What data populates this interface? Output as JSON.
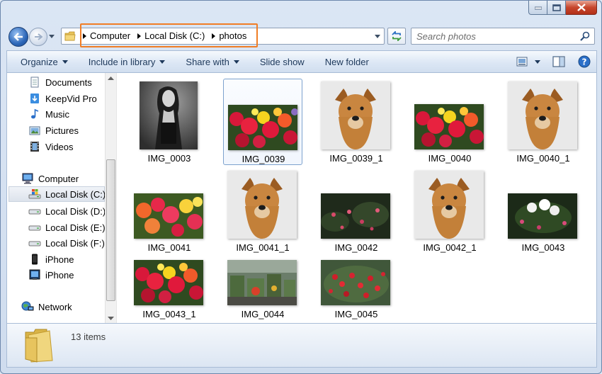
{
  "breadcrumb": [
    "Computer",
    "Local Disk (C:)",
    "photos"
  ],
  "search": {
    "placeholder": "Search photos"
  },
  "toolbar": {
    "organize": "Organize",
    "include_in_library": "Include in library",
    "share_with": "Share with",
    "slide_show": "Slide show",
    "new_folder": "New folder"
  },
  "navpane": {
    "favorites": [
      {
        "label": "Documents",
        "icon": "documents-icon"
      },
      {
        "label": "KeepVid Pro",
        "icon": "keepvid-icon"
      },
      {
        "label": "Music",
        "icon": "music-icon"
      },
      {
        "label": "Pictures",
        "icon": "pictures-icon"
      },
      {
        "label": "Videos",
        "icon": "videos-icon"
      }
    ],
    "computer": "Computer",
    "drives": [
      {
        "label": "Local Disk (C:)",
        "icon": "windows-drive-icon",
        "selected": true
      },
      {
        "label": "Local Disk (D:)",
        "icon": "drive-icon"
      },
      {
        "label": "Local Disk (E:)",
        "icon": "drive-icon"
      },
      {
        "label": "Local Disk (F:)",
        "icon": "drive-icon"
      },
      {
        "label": "iPhone",
        "icon": "phone-icon"
      },
      {
        "label": "iPhone",
        "icon": "phone-camera-icon"
      }
    ],
    "network": "Network"
  },
  "files": [
    {
      "name": "IMG_0003",
      "kind": "portrait"
    },
    {
      "name": "IMG_0039",
      "kind": "flowers",
      "selected": true
    },
    {
      "name": "IMG_0039_1",
      "kind": "dog"
    },
    {
      "name": "IMG_0040",
      "kind": "flowers"
    },
    {
      "name": "IMG_0040_1",
      "kind": "dog"
    },
    {
      "name": "IMG_0041",
      "kind": "flowers2"
    },
    {
      "name": "IMG_0041_1",
      "kind": "dog"
    },
    {
      "name": "IMG_0042",
      "kind": "dark-garden"
    },
    {
      "name": "IMG_0042_1",
      "kind": "dog"
    },
    {
      "name": "IMG_0043",
      "kind": "white-flowers"
    },
    {
      "name": "IMG_0043_1",
      "kind": "flowers"
    },
    {
      "name": "IMG_0044",
      "kind": "market"
    },
    {
      "name": "IMG_0045",
      "kind": "red-berries"
    }
  ],
  "details": {
    "item_count": "13 items"
  },
  "colors": {
    "highlight": "#f07d25",
    "toolbar_text": "#1e395b"
  }
}
